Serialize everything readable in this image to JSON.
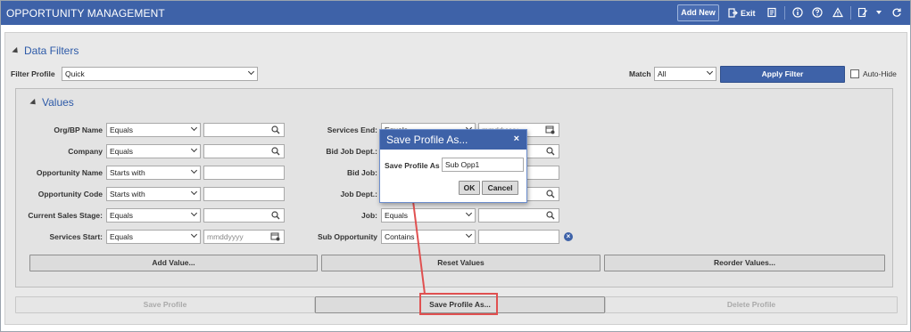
{
  "app": {
    "title": "OPPORTUNITY MANAGEMENT"
  },
  "toolbar": {
    "add_new": "Add New",
    "exit": "Exit"
  },
  "data_filters": {
    "title": "Data Filters",
    "filter_profile_label": "Filter Profile",
    "filter_profile_value": "Quick",
    "match_label": "Match",
    "match_value": "All",
    "apply_label": "Apply Filter",
    "auto_hide_label": "Auto-Hide"
  },
  "values": {
    "title": "Values",
    "left_rows": [
      {
        "label": "Org/BP Name",
        "operator": "Equals",
        "value": "",
        "kind": "search"
      },
      {
        "label": "Company",
        "operator": "Equals",
        "value": "",
        "kind": "search"
      },
      {
        "label": "Opportunity Name",
        "operator": "Starts with",
        "value": "",
        "kind": "text"
      },
      {
        "label": "Opportunity Code",
        "operator": "Starts with",
        "value": "",
        "kind": "text"
      },
      {
        "label": "Current Sales Stage:",
        "operator": "Equals",
        "value": "",
        "kind": "search"
      },
      {
        "label": "Services Start:",
        "operator": "Equals",
        "value": "mmddyyyy",
        "kind": "date"
      }
    ],
    "right_rows": [
      {
        "label": "Services End:",
        "operator": "Equals",
        "value": "mmddyyyy",
        "kind": "date"
      },
      {
        "label": "Bid Job Dept.:",
        "operator": "",
        "value": "",
        "kind": "search"
      },
      {
        "label": "Bid Job:",
        "operator": "",
        "value": "",
        "kind": "text"
      },
      {
        "label": "Job Dept.:",
        "operator": "",
        "value": "",
        "kind": "search"
      },
      {
        "label": "Job:",
        "operator": "Equals",
        "value": "",
        "kind": "search"
      },
      {
        "label": "Sub Opportunity",
        "operator": "Contains",
        "value": "",
        "kind": "clear"
      }
    ],
    "add_value": "Add Value...",
    "reset_values": "Reset Values",
    "reorder_values": "Reorder Values..."
  },
  "profile_buttons": {
    "save_profile": "Save Profile",
    "save_profile_as": "Save Profile As...",
    "delete_profile": "Delete Profile"
  },
  "dialog": {
    "title": "Save Profile As...",
    "close": "×",
    "field_label": "Save Profile As",
    "field_value": "Sub Opp1",
    "ok": "OK",
    "cancel": "Cancel"
  },
  "colors": {
    "brand": "#3e62a8",
    "annotation": "#e05050"
  }
}
